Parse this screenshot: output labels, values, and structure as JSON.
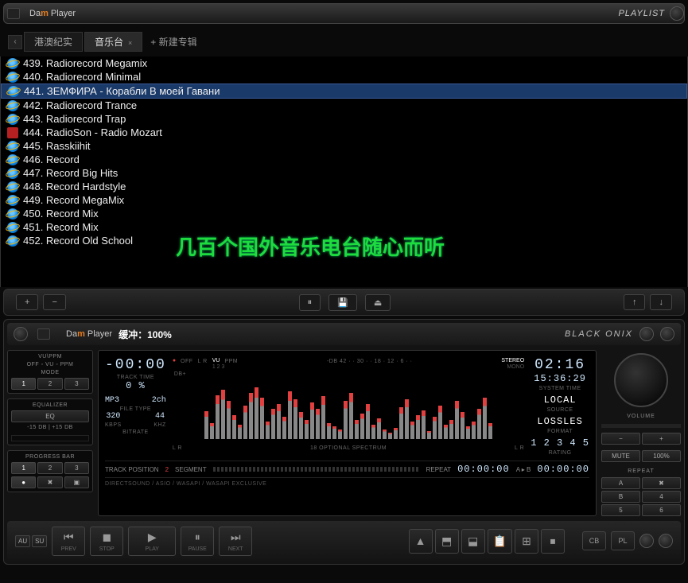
{
  "header": {
    "brand_prefix": "Da",
    "brand_mid": "m",
    "brand_suffix": "Player",
    "playlist_label": "PLAYLIST"
  },
  "tabs": {
    "prev": "‹",
    "items": [
      {
        "label": "港澳纪实",
        "active": false
      },
      {
        "label": "音乐台",
        "active": true
      }
    ],
    "new_label": "+ 新建专辑"
  },
  "tracks": [
    {
      "num": "439",
      "name": "Radiorecord Megamix",
      "icon": "ie"
    },
    {
      "num": "440",
      "name": "Radiorecord Minimal",
      "icon": "ie"
    },
    {
      "num": "441",
      "name": "ЗЕМФИРА - Корабли В моей Гавани",
      "icon": "ie",
      "selected": true
    },
    {
      "num": "442",
      "name": "Radiorecord Trance",
      "icon": "ie"
    },
    {
      "num": "443",
      "name": "Radiorecord Trap",
      "icon": "ie"
    },
    {
      "num": "444",
      "name": "RadioSon - Radio Mozart",
      "icon": "red"
    },
    {
      "num": "445",
      "name": "Rasskiihit",
      "icon": "ie"
    },
    {
      "num": "446",
      "name": "Record",
      "icon": "ie"
    },
    {
      "num": "447",
      "name": "Record Big Hits",
      "icon": "ie"
    },
    {
      "num": "448",
      "name": "Record Hardstyle",
      "icon": "ie"
    },
    {
      "num": "449",
      "name": "Record MegaMix",
      "icon": "ie"
    },
    {
      "num": "450",
      "name": "Record Mix",
      "icon": "ie"
    },
    {
      "num": "451",
      "name": "Record Mix",
      "icon": "ie"
    },
    {
      "num": "452",
      "name": "Record Old School",
      "icon": "ie"
    }
  ],
  "overlay": "几百个国外音乐电台随心而听",
  "playlist_bar": {
    "add": "+",
    "remove": "−",
    "mid1": "⏸",
    "mid2": "💾",
    "mid3": "⏏",
    "up": "↑",
    "down": "↓"
  },
  "player_header": {
    "brand": "Da m Player",
    "status": "缓冲：100%",
    "skin": "BLACK ONIX"
  },
  "left_panel": {
    "vuppm_label": "VU\\PPM",
    "vuppm_row": "OFF ◦ VU ◦ PPM",
    "mode_label": "MODE",
    "modes": [
      "1",
      "2",
      "3"
    ],
    "eq_label": "EQUALIZER",
    "eq_btn": "EQ",
    "eq_minus": "-15 DB",
    "eq_div": "|",
    "eq_plus": "+15 DB",
    "progress_label": "PROGRESS BAR",
    "progress_btns": [
      "1",
      "2",
      "3"
    ],
    "rec_btns": [
      "●",
      "✖",
      "▣"
    ]
  },
  "display": {
    "neg_time": "-00:00",
    "track_time_label": "TRACK TIME",
    "percent": "0 %",
    "off_label": "OFF",
    "lr": "L R",
    "vu": "VU",
    "ppm": "PPM",
    "vu_nums": "1  2  3",
    "db_label": "-DB 42 · · 30 · · 18 · 12 · 6 · ·",
    "db_plus": "DB+",
    "stereo": "STEREO",
    "mono": "MONO",
    "elapsed": "02:16",
    "system_time": "15:36:29",
    "system_label": "SYSTEM TIME",
    "local": "LOCAL",
    "source_label": "SOURCE",
    "lossles": "LOSSLES",
    "format_label": "FORMAT",
    "rating_val": "1 2 3 4 5",
    "rating_label": "RATING",
    "mp3": "MP3",
    "ch": "2ch",
    "file_type": "FILE TYPE",
    "kbps": "320",
    "kbps_lbl": "KBPS",
    "khz": "44",
    "khz_lbl": "KHZ",
    "bitrate_lbl": "BITRATE",
    "spectrum_lbl": "18 OPTIONAL SPECTRUM",
    "track_pos": "TRACK POSITION",
    "pos_num": "2",
    "segment": "SEGMENT",
    "repeat_lbl": "REPEAT",
    "t1": "00:00:00",
    "ab": "A ▸ B",
    "t2": "00:00:00",
    "footer": "DIRECTSOUND / ASIO / WASAPI / WASAPI EXCLUSIVE"
  },
  "right_panel": {
    "volume": "VOLUME",
    "minus": "−",
    "plus": "+",
    "mute": "MUTE",
    "p100": "100%",
    "repeat": "REPEAT",
    "btns": [
      "A",
      "✖",
      "B",
      "4",
      "5",
      "6"
    ]
  },
  "transport": {
    "au": "AU",
    "su": "SU",
    "prev": "PREV",
    "stop": "STOP",
    "play": "PLAY",
    "pause": "PAUSE",
    "next": "NEXT",
    "prev_i": "⏮",
    "stop_i": "◼",
    "play_i": "▶",
    "pause_i": "⏸",
    "next_i": "⏭",
    "aux": [
      "▲",
      "⬒",
      "⬓",
      "📋",
      "⊞",
      "⏹"
    ],
    "cb": "CB",
    "pl": "PL",
    "c1": "○",
    "c2": "○"
  },
  "spectrum_bars": [
    35,
    20,
    55,
    62,
    48,
    30,
    18,
    42,
    58,
    65,
    52,
    22,
    38,
    44,
    28,
    60,
    50,
    34,
    24,
    46,
    38,
    54,
    20,
    16,
    12,
    48,
    58,
    24,
    32,
    44,
    18,
    26,
    12,
    8,
    14,
    40,
    50,
    22,
    30,
    36,
    10,
    28,
    42,
    18,
    24,
    48,
    34,
    16,
    22,
    38,
    52,
    20
  ]
}
